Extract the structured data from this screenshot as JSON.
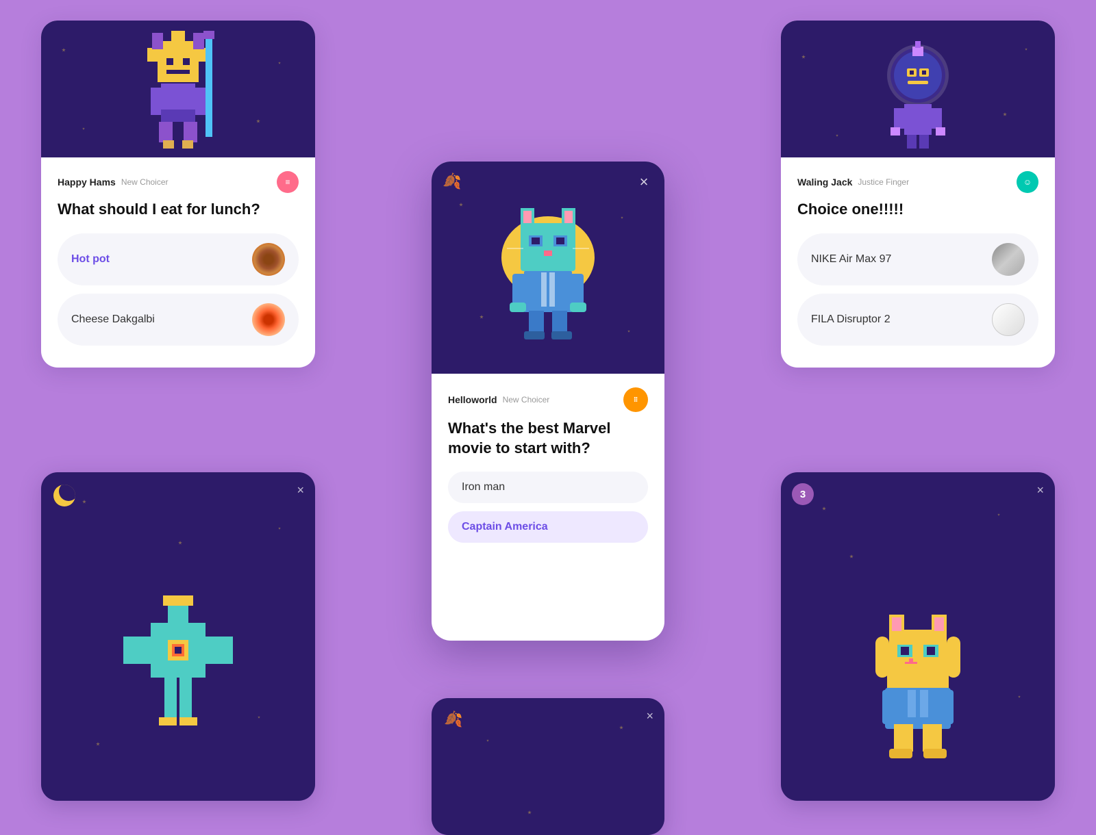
{
  "app": {
    "background_color": "#b67edc"
  },
  "card1": {
    "username": "Happy Hams",
    "tag": "New Choicer",
    "question": "What should I eat for lunch?",
    "choices": [
      {
        "label": "Hot pot",
        "selected": true,
        "has_image": true
      },
      {
        "label": "Cheese Dakgalbi",
        "selected": false,
        "has_image": true
      }
    ]
  },
  "card2": {
    "username": "Waling Jack",
    "tag": "Justice Finger",
    "question": "Choice one!!!!!",
    "choices": [
      {
        "label": "NIKE Air Max 97",
        "has_image": true
      },
      {
        "label": "FILA Disruptor 2",
        "has_image": true
      }
    ]
  },
  "center_card": {
    "username": "Helloworld",
    "tag": "New Choicer",
    "question": "What's the best Marvel movie to start with?",
    "choices": [
      {
        "label": "Iron man",
        "selected": false
      },
      {
        "label": "Captain America",
        "selected": true
      }
    ],
    "close_label": "×"
  },
  "bottom_left_card": {
    "close_label": "×"
  },
  "bottom_right_card": {
    "badge_number": "3",
    "close_label": "×"
  },
  "bottom_center_card": {
    "close_label": "×"
  },
  "icons": {
    "close": "×",
    "leaf": "🍂",
    "moon": "🌙",
    "badge_bars": "▐▌",
    "badge_face": "☺",
    "badge_dots": "⠿"
  }
}
